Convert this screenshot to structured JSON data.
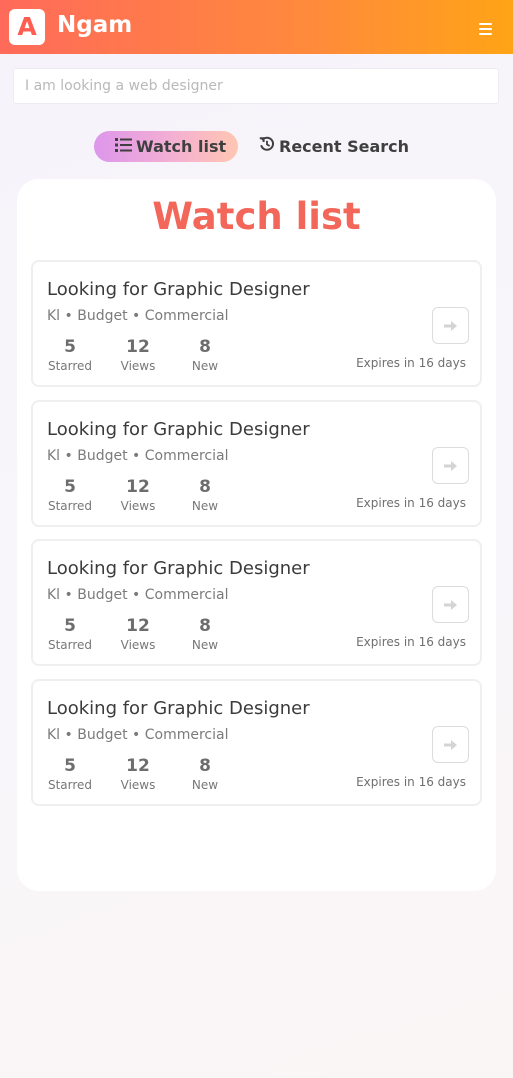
{
  "header": {
    "logo_letter": "A",
    "brand": "Ngam",
    "menu_icon": "hamburger-icon"
  },
  "search": {
    "placeholder": "I am looking a web designer",
    "value": ""
  },
  "tabs": [
    {
      "label": "Watch list",
      "icon": "list-icon",
      "active": true
    },
    {
      "label": "Recent Search",
      "icon": "history-icon",
      "active": false
    }
  ],
  "panel": {
    "title": "Watch list"
  },
  "cards": [
    {
      "title": "Looking for Graphic Designer",
      "meta": "Kl • Budget • Commercial",
      "stats": [
        {
          "value": "5",
          "label": "Starred"
        },
        {
          "value": "12",
          "label": "Views"
        },
        {
          "value": "8",
          "label": "New"
        }
      ],
      "expiry": "Expires in 16 days"
    },
    {
      "title": "Looking for Graphic Designer",
      "meta": "Kl • Budget • Commercial",
      "stats": [
        {
          "value": "5",
          "label": "Starred"
        },
        {
          "value": "12",
          "label": "Views"
        },
        {
          "value": "8",
          "label": "New"
        }
      ],
      "expiry": "Expires in 16 days"
    },
    {
      "title": "Looking for Graphic Designer",
      "meta": "Kl • Budget • Commercial",
      "stats": [
        {
          "value": "5",
          "label": "Starred"
        },
        {
          "value": "12",
          "label": "Views"
        },
        {
          "value": "8",
          "label": "New"
        }
      ],
      "expiry": "Expires in 16 days"
    },
    {
      "title": "Looking for Graphic Designer",
      "meta": "Kl • Budget • Commercial",
      "stats": [
        {
          "value": "5",
          "label": "Starred"
        },
        {
          "value": "12",
          "label": "Views"
        },
        {
          "value": "8",
          "label": "New"
        }
      ],
      "expiry": "Expires in 16 days"
    }
  ],
  "colors": {
    "header_start": "#ff6a5a",
    "header_end": "#ffa416",
    "accent": "#f2675a",
    "tab_active_start": "#dd96ec",
    "tab_active_end": "#ffc6b2"
  }
}
